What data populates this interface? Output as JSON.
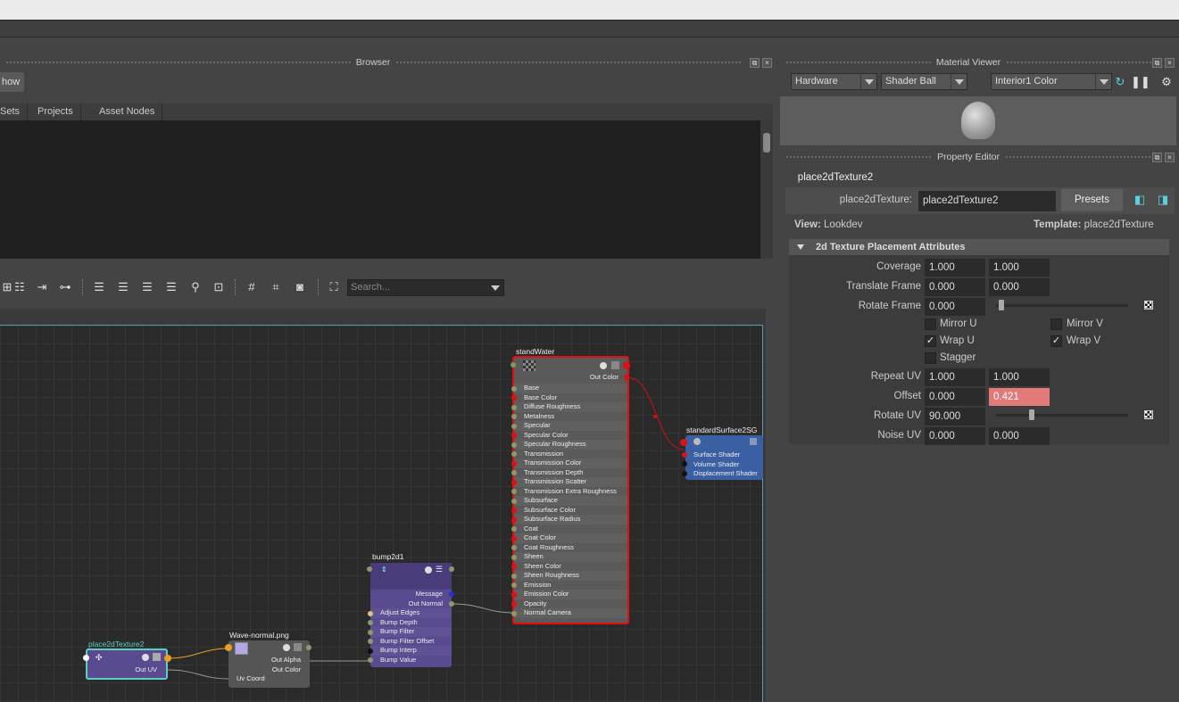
{
  "browser": {
    "title": "Browser",
    "show_button": "how",
    "tabs": [
      "Sets",
      "Projects",
      "Asset Nodes"
    ]
  },
  "toolbar": {
    "search_placeholder": "Search..."
  },
  "graph": {
    "standWater": {
      "title": "standWater",
      "out": "Out Color",
      "attrs": [
        "Base",
        "Base Color",
        "Diffuse Roughness",
        "Metalness",
        "Specular",
        "Specular Color",
        "Specular Roughness",
        "Transmission",
        "Transmission Color",
        "Transmission Depth",
        "Transmission Scatter",
        "Transmission Extra Roughness",
        "Subsurface",
        "Subsurface Color",
        "Subsurface Radius",
        "Coat",
        "Coat Color",
        "Coat Roughness",
        "Sheen",
        "Sheen Color",
        "Sheen Roughness",
        "Emission",
        "Emission Color",
        "Opacity",
        "Normal Camera"
      ]
    },
    "shadingGroup": {
      "title": "standardSurface2SG",
      "attrs": [
        "Surface Shader",
        "Volume Shader",
        "Displacement Shader"
      ]
    },
    "bump": {
      "title": "bump2d1",
      "outs": [
        "Message",
        "Out Normal"
      ],
      "attrs": [
        "Adjust Edges",
        "Bump Depth",
        "Bump Filter",
        "Bump Filter Offset",
        "Bump Interp",
        "Bump Value"
      ]
    },
    "wave": {
      "title": "Wave-normal.png",
      "outs": [
        "Out Alpha",
        "Out Color"
      ],
      "attrs": [
        "Uv Coord"
      ]
    },
    "place": {
      "title": "place2dTexture2",
      "out": "Out UV"
    }
  },
  "material_viewer": {
    "title": "Material Viewer",
    "renderer": "Hardware",
    "shape": "Shader Ball",
    "environment": "Interior1 Color"
  },
  "property_editor": {
    "title": "Property Editor",
    "tab": "place2dTexture2",
    "node_type_label": "place2dTexture:",
    "node_name": "place2dTexture2",
    "presets": "Presets",
    "view_label": "View:",
    "view_value": "Lookdev",
    "template_label": "Template:",
    "template_value": "place2dTexture",
    "section": "2d Texture Placement Attributes",
    "coverage": {
      "label": "Coverage",
      "u": "1.000",
      "v": "1.000"
    },
    "translate_frame": {
      "label": "Translate Frame",
      "u": "0.000",
      "v": "0.000"
    },
    "rotate_frame": {
      "label": "Rotate Frame",
      "value": "0.000"
    },
    "mirror_u": {
      "label": "Mirror U",
      "checked": false
    },
    "mirror_v": {
      "label": "Mirror V",
      "checked": false
    },
    "wrap_u": {
      "label": "Wrap U",
      "checked": true
    },
    "wrap_v": {
      "label": "Wrap V",
      "checked": true
    },
    "stagger": {
      "label": "Stagger",
      "checked": false
    },
    "repeat_uv": {
      "label": "Repeat UV",
      "u": "1.000",
      "v": "1.000"
    },
    "offset": {
      "label": "Offset",
      "u": "0.000",
      "v": "0.421"
    },
    "rotate_uv": {
      "label": "Rotate UV",
      "value": "90.000"
    },
    "noise_uv": {
      "label": "Noise UV",
      "u": "0.000",
      "v": "0.000"
    },
    "check_glyph": "✓"
  },
  "colors": {
    "highlight_field": "#e27a7a",
    "shader_node_border": "#e01010",
    "sg_node": "#3a5fa3",
    "bump_node": "#5a4a90",
    "place_border": "#5ad0c0"
  }
}
